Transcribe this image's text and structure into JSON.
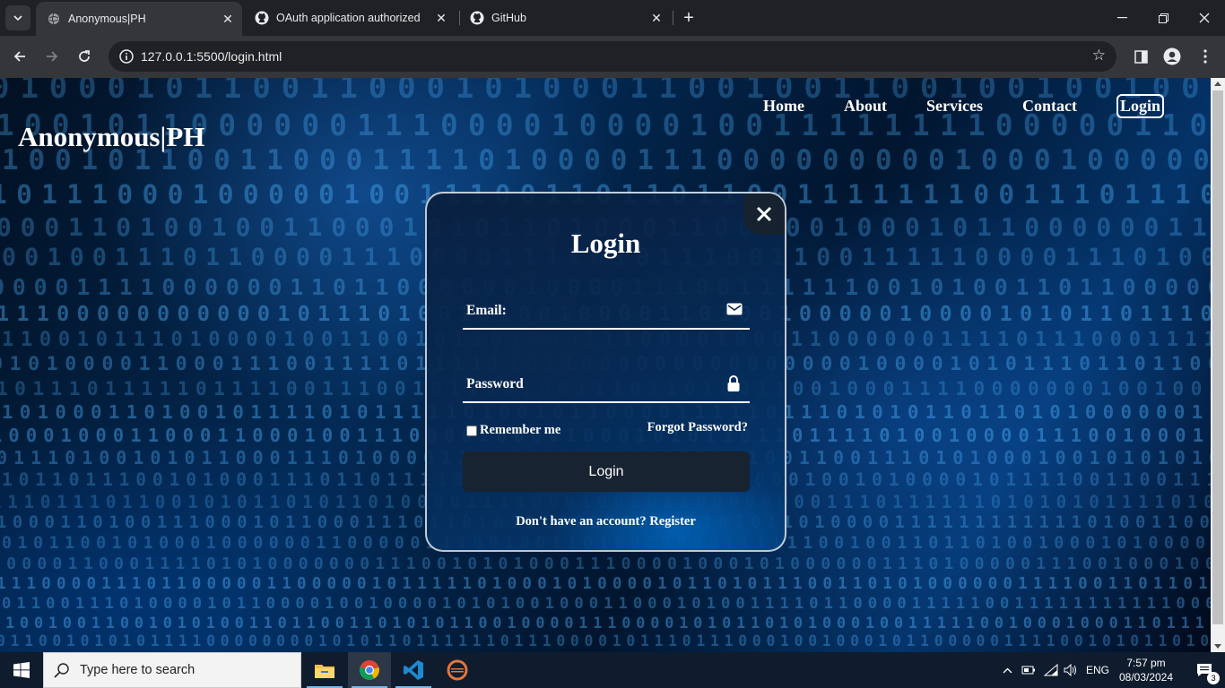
{
  "browser": {
    "tabs": [
      {
        "title": "Anonymous|PH",
        "favicon": "globe-icon",
        "active": true
      },
      {
        "title": "OAuth application authorized",
        "favicon": "github-icon",
        "active": false
      },
      {
        "title": "GitHub",
        "favicon": "github-icon",
        "active": false
      }
    ],
    "url": "127.0.0.1:5500/login.html"
  },
  "site": {
    "logo": "Anonymous|PH",
    "nav": [
      "Home",
      "About",
      "Services",
      "Contact",
      "Login"
    ]
  },
  "login_modal": {
    "title": "Login",
    "email_label": "Email:",
    "password_label": "Password",
    "remember_label": "Remember me",
    "forgot_label": "Forgot Password?",
    "submit_label": "Login",
    "register_prompt": "Don't have an account?",
    "register_link": "Register",
    "remember_checked": false
  },
  "taskbar": {
    "search_placeholder": "Type here to search",
    "language": "ENG",
    "time": "7:57 pm",
    "date": "08/03/2024",
    "notification_count": "3"
  },
  "colors": {
    "accent_blue": "#2a8cff",
    "chrome_dark": "#202124",
    "toolbar": "#35363a",
    "button_dark": "#172330"
  }
}
